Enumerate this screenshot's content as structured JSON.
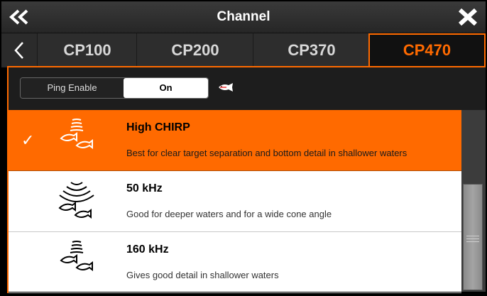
{
  "header": {
    "title": "Channel",
    "back_icon": "double-chevron-left-icon",
    "close_icon": "close-x-icon"
  },
  "tabs": {
    "prev_icon": "chevron-left-icon",
    "items": [
      {
        "label": "CP100",
        "active": false
      },
      {
        "label": "CP200",
        "active": false
      },
      {
        "label": "CP370",
        "active": false
      },
      {
        "label": "CP470",
        "active": true
      }
    ]
  },
  "ping": {
    "label": "Ping Enable",
    "value": "On",
    "icon": "fish-ping-icon"
  },
  "list": {
    "items": [
      {
        "title": "High CHIRP",
        "description": "Best for clear target separation and bottom detail in shallower waters",
        "selected": true,
        "icon": "narrow-beam-fish-icon"
      },
      {
        "title": "50 kHz",
        "description": "Good for deeper waters and for a wide cone angle",
        "selected": false,
        "icon": "wide-beam-fish-icon"
      },
      {
        "title": "160 kHz",
        "description": "Gives good detail in shallower waters",
        "selected": false,
        "icon": "narrow-beam-fish-icon"
      }
    ],
    "check_glyph": "✓"
  },
  "colors": {
    "accent": "#ff6a00",
    "selected_bg": "#ff6a00",
    "header_bg": "#2d2d2d"
  }
}
